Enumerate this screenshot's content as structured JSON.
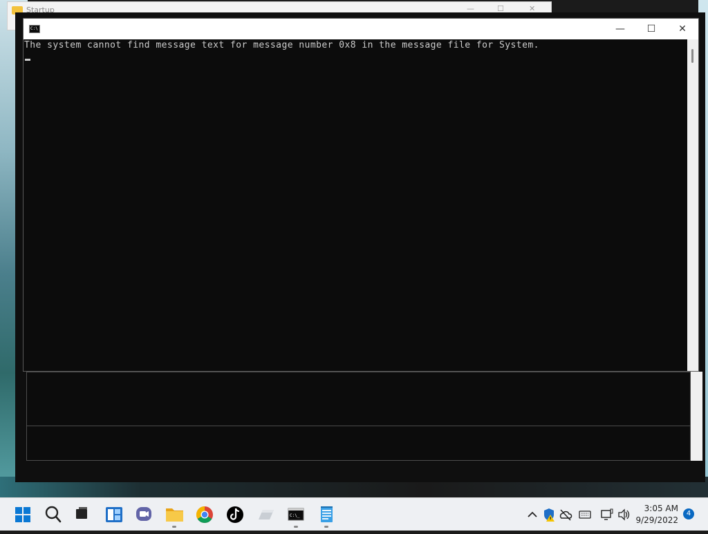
{
  "background_window": {
    "title": "Startup",
    "controls": [
      "—",
      "☐",
      "✕"
    ]
  },
  "console": {
    "window_controls": {
      "minimize": "—",
      "maximize": "☐",
      "close": "✕"
    },
    "icon_text": "C:\\",
    "output_lines": [
      "The system cannot find message text for message number 0x8 in the message file for System."
    ]
  },
  "taskbar": {
    "apps": [
      {
        "name": "start",
        "icon": "windows-logo-icon"
      },
      {
        "name": "search",
        "icon": "search-icon"
      },
      {
        "name": "task-view",
        "icon": "task-view-icon"
      },
      {
        "name": "widgets",
        "icon": "widgets-icon"
      },
      {
        "name": "chat",
        "icon": "teams-chat-icon"
      },
      {
        "name": "file-explorer",
        "icon": "folder-icon"
      },
      {
        "name": "chrome",
        "icon": "chrome-icon"
      },
      {
        "name": "tiktok",
        "icon": "tiktok-icon"
      },
      {
        "name": "app-generic",
        "icon": "app-tile-icon"
      },
      {
        "name": "command-prompt",
        "icon": "terminal-icon"
      },
      {
        "name": "notepad",
        "icon": "notepad-icon"
      }
    ],
    "tray": {
      "time": "3:05 AM",
      "date": "9/29/2022",
      "notification_count": "4"
    }
  },
  "colors": {
    "console_bg": "#0c0c0c",
    "console_text": "#cccccc",
    "accent": "#0a78d4",
    "taskbar_bg": "#eef0f3"
  }
}
